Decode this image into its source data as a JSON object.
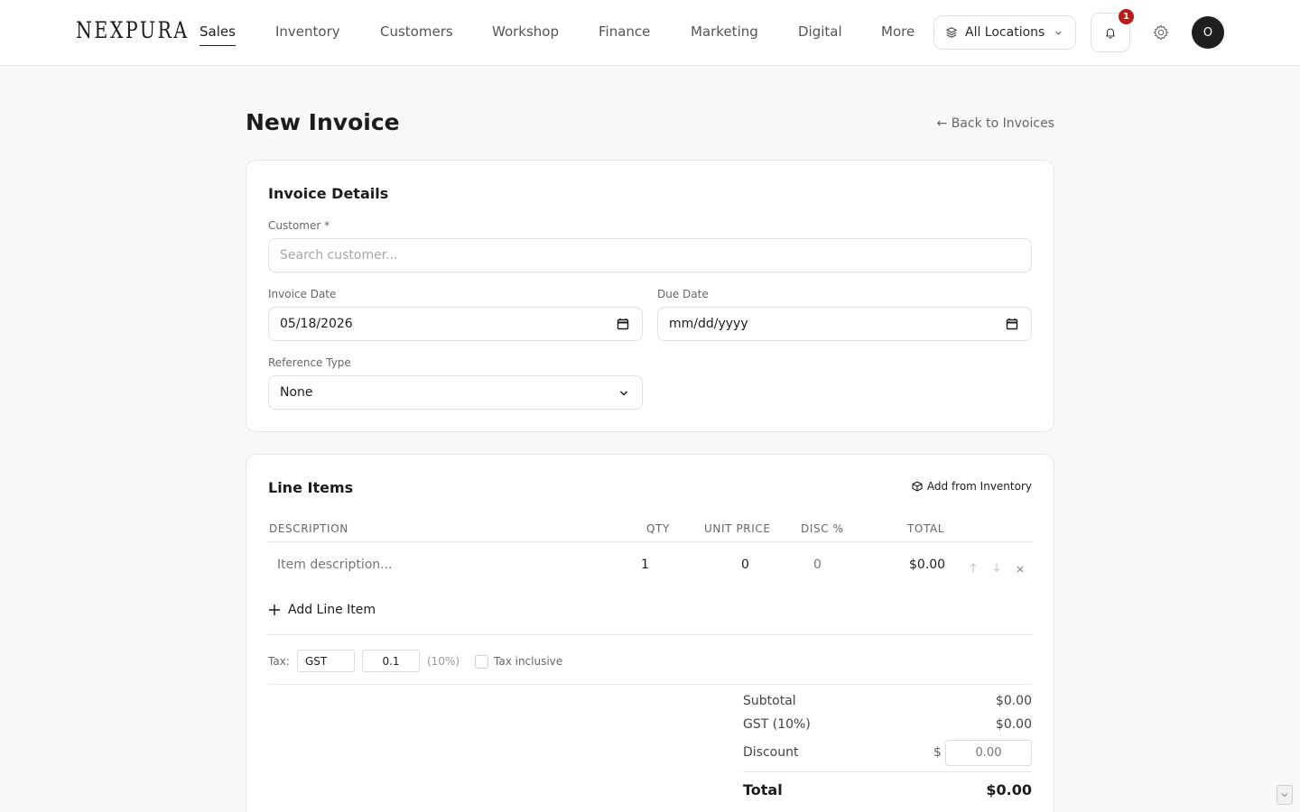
{
  "nav": {
    "logo": "NEXPURA",
    "items": [
      "Sales",
      "Inventory",
      "Customers",
      "Workshop",
      "Finance",
      "Marketing",
      "Digital",
      "More"
    ],
    "active": "Sales",
    "location": "All Locations",
    "notification_count": "1",
    "avatar_initial": "O"
  },
  "header": {
    "title": "New Invoice",
    "back_link": "← Back to Invoices"
  },
  "details": {
    "title": "Invoice Details",
    "customer_label": "Customer *",
    "customer_placeholder": "Search customer...",
    "invoice_date_label": "Invoice Date",
    "invoice_date_value": "05/18/2026",
    "due_date_label": "Due Date",
    "due_date_value": "mm/dd/yyyy",
    "reference_label": "Reference Type",
    "reference_value": "None"
  },
  "line_items": {
    "title": "Line Items",
    "add_from_inventory": "Add from Inventory",
    "columns": [
      "DESCRIPTION",
      "QTY",
      "UNIT PRICE",
      "DISC %",
      "TOTAL"
    ],
    "rows": [
      {
        "description_placeholder": "Item description...",
        "qty": "1",
        "unit_price": "0",
        "disc": "0",
        "total": "$0.00"
      }
    ],
    "add_line": "Add Line Item"
  },
  "tax": {
    "label": "Tax:",
    "name": "GST",
    "rate": "0.1",
    "rate_display": "(10%)",
    "inclusive_label": "Tax inclusive"
  },
  "totals": {
    "subtotal_label": "Subtotal",
    "subtotal": "$0.00",
    "gst_label": "GST (10%)",
    "gst": "$0.00",
    "discount_label": "Discount",
    "discount_currency": "$",
    "discount_placeholder": "0.00",
    "total_label": "Total",
    "total": "$0.00"
  },
  "colors": {
    "badge": "#b91c1c",
    "avatar": "#1f1f1f",
    "background": "#f8f8f7"
  }
}
